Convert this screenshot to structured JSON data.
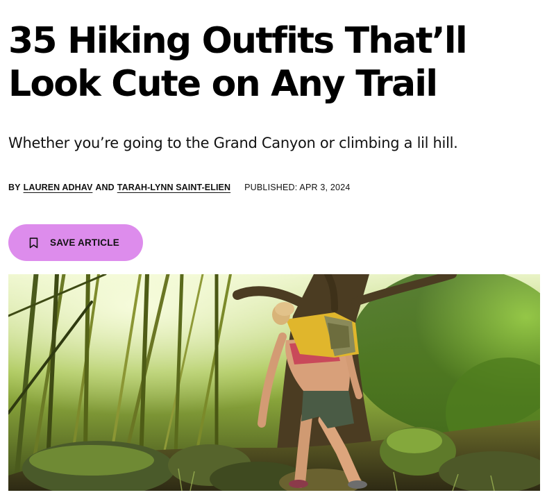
{
  "article": {
    "title": "35 Hiking Outfits That’ll Look Cute on Any Trail",
    "dek": "Whether you’re going to the Grand Canyon or climbing a lil hill.",
    "byline": {
      "by": "BY",
      "author_1": "LAUREN ADHAV",
      "and": "AND",
      "author_2": "TARAH-LYNN SAINT-ELIEN",
      "published": "PUBLISHED: APR 3, 2024"
    },
    "save": {
      "label": "SAVE ARTICLE",
      "icon": "bookmark-icon",
      "color": "#dd8cec"
    },
    "hero_image": {
      "subject": "hiker-on-forest-trail"
    }
  }
}
